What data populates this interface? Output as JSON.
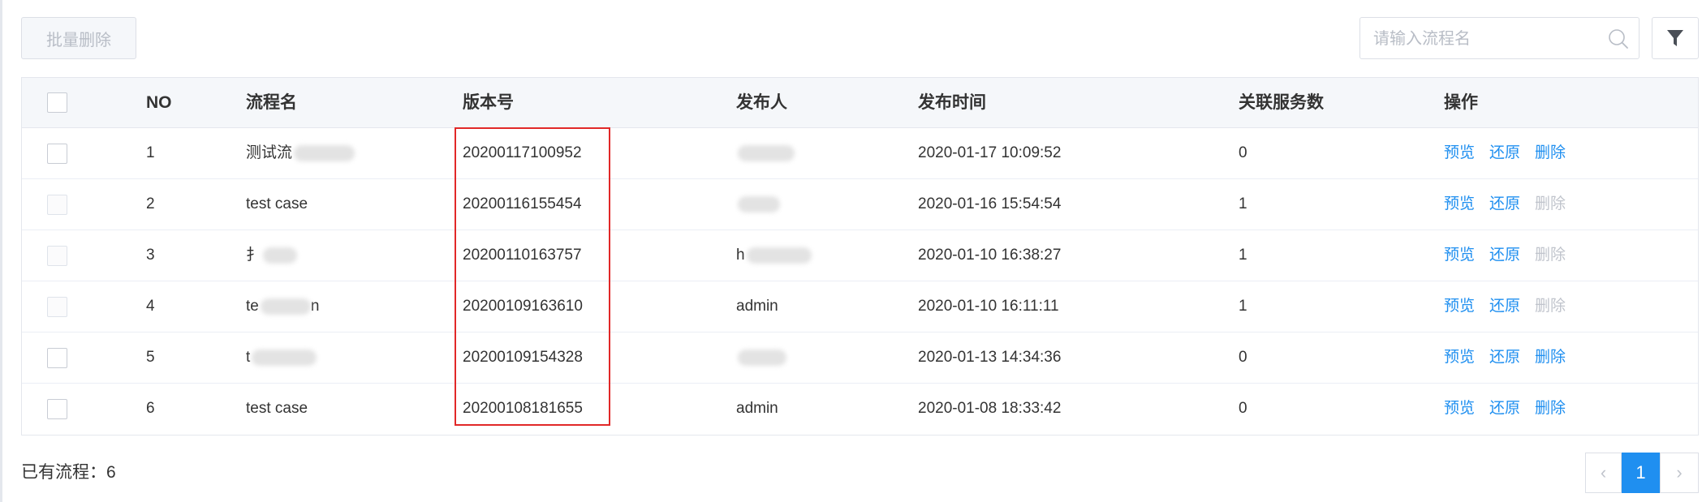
{
  "toolbar": {
    "batch_delete_label": "批量删除",
    "search_placeholder": "请输入流程名",
    "search_value": ""
  },
  "table": {
    "columns": {
      "no": "NO",
      "name": "流程名",
      "version": "版本号",
      "publisher": "发布人",
      "publish_time": "发布时间",
      "service_count": "关联服务数",
      "actions": "操作"
    },
    "rows": [
      {
        "no": "1",
        "name": "测试流",
        "version": "20200117100952",
        "publisher": "",
        "publish_time": "2020-01-17 10:09:52",
        "service_count": "0",
        "preview": "预览",
        "restore": "还原",
        "delete": "删除",
        "checkbox_enabled": true,
        "delete_enabled": true
      },
      {
        "no": "2",
        "name": "test case",
        "version": "20200116155454",
        "publisher": "",
        "publish_time": "2020-01-16 15:54:54",
        "service_count": "1",
        "preview": "预览",
        "restore": "还原",
        "delete": "删除",
        "checkbox_enabled": false,
        "delete_enabled": false
      },
      {
        "no": "3",
        "name": "扌",
        "version": "20200110163757",
        "publisher": "h",
        "publish_time": "2020-01-10 16:38:27",
        "service_count": "1",
        "preview": "预览",
        "restore": "还原",
        "delete": "删除",
        "checkbox_enabled": false,
        "delete_enabled": false
      },
      {
        "no": "4",
        "name": "te",
        "name_suffix": "n",
        "version": "20200109163610",
        "publisher": "admin",
        "publish_time": "2020-01-10 16:11:11",
        "service_count": "1",
        "preview": "预览",
        "restore": "还原",
        "delete": "删除",
        "checkbox_enabled": false,
        "delete_enabled": false
      },
      {
        "no": "5",
        "name": "t",
        "version": "20200109154328",
        "publisher": "",
        "publish_time": "2020-01-13 14:34:36",
        "service_count": "0",
        "preview": "预览",
        "restore": "还原",
        "delete": "删除",
        "checkbox_enabled": true,
        "delete_enabled": true
      },
      {
        "no": "6",
        "name": "test case",
        "version": "20200108181655",
        "publisher": "admin",
        "publish_time": "2020-01-08 18:33:42",
        "service_count": "0",
        "preview": "预览",
        "restore": "还原",
        "delete": "删除",
        "checkbox_enabled": true,
        "delete_enabled": true
      }
    ]
  },
  "footer": {
    "total_label": "已有流程：6"
  },
  "pagination": {
    "prev": "‹",
    "current_page": "1",
    "next": "›"
  },
  "icons": {
    "search": "search-icon",
    "filter": "filter-icon"
  },
  "colors": {
    "link": "#1f8ff0",
    "disabled_link": "#c0c4cc",
    "highlight_box": "#e12828",
    "active_page": "#1f8ff0"
  }
}
